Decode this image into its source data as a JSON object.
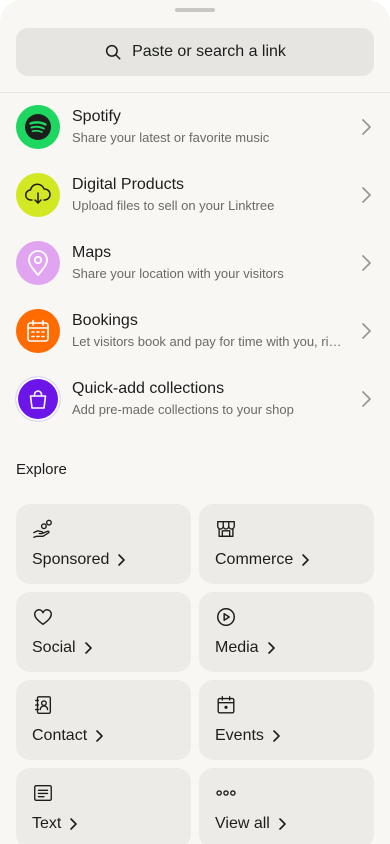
{
  "search": {
    "label": "Paste or search a link"
  },
  "links": [
    {
      "title": "Spotify",
      "subtitle": "Share your latest or favorite music",
      "icon": "spotify-icon",
      "color": "#1ed760"
    },
    {
      "title": "Digital Products",
      "subtitle": "Upload files to sell on your Linktree",
      "icon": "cloud-download-icon",
      "color": "#d2e823"
    },
    {
      "title": "Maps",
      "subtitle": "Share your location with your visitors",
      "icon": "map-pin-icon",
      "color": "#e1a4f0"
    },
    {
      "title": "Bookings",
      "subtitle": "Let visitors book and pay for time with you, right from your Linktree",
      "icon": "calendar-grid-icon",
      "color": "#ff6b00"
    },
    {
      "title": "Quick-add collections",
      "subtitle": "Add pre-made collections to your shop",
      "icon": "shopping-bag-icon",
      "color": "#6b15e8"
    }
  ],
  "explore": {
    "label": "Explore",
    "tiles": [
      {
        "label": "Sponsored",
        "icon": "hand-coins-icon"
      },
      {
        "label": "Commerce",
        "icon": "storefront-icon"
      },
      {
        "label": "Social",
        "icon": "heart-icon"
      },
      {
        "label": "Media",
        "icon": "play-circle-icon"
      },
      {
        "label": "Contact",
        "icon": "contact-book-icon"
      },
      {
        "label": "Events",
        "icon": "calendar-icon"
      },
      {
        "label": "Text",
        "icon": "text-lines-icon"
      },
      {
        "label": "View all",
        "icon": "more-dots-icon"
      }
    ]
  }
}
